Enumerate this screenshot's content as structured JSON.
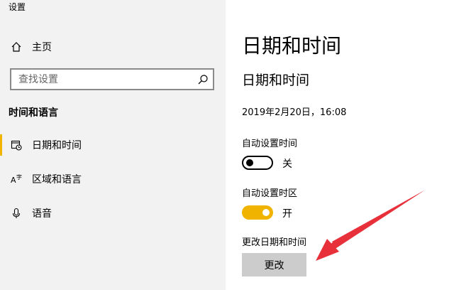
{
  "app": {
    "title": "设置"
  },
  "sidebar": {
    "home_label": "主页",
    "search_placeholder": "查找设置",
    "section_title": "时间和语言",
    "items": [
      {
        "label": "日期和时间",
        "icon": "calendar-clock-icon",
        "active": true
      },
      {
        "label": "区域和语言",
        "icon": "language-icon",
        "active": false
      },
      {
        "label": "语音",
        "icon": "microphone-icon",
        "active": false
      }
    ]
  },
  "main": {
    "page_title": "日期和时间",
    "sub_title": "日期和时间",
    "current_datetime": "2019年2月20日，16:08",
    "auto_time": {
      "label": "自动设置时间",
      "state": "关",
      "on": false
    },
    "auto_timezone": {
      "label": "自动设置时区",
      "state": "开",
      "on": true
    },
    "change_section": {
      "label": "更改日期和时间",
      "button": "更改"
    }
  },
  "colors": {
    "accent": "#f0b400",
    "arrow": "#e8303a"
  }
}
